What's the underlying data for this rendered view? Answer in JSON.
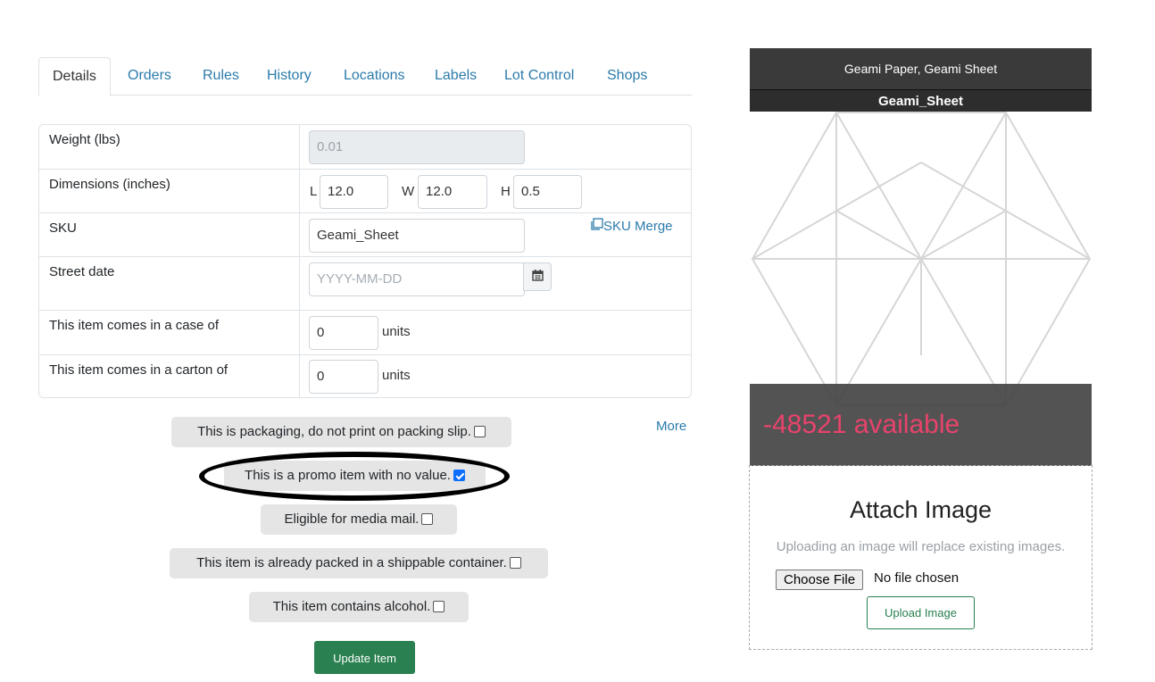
{
  "tabs": [
    {
      "label": "Details",
      "active": true
    },
    {
      "label": "Orders"
    },
    {
      "label": "Rules"
    },
    {
      "label": "History"
    },
    {
      "label": "Locations"
    },
    {
      "label": "Labels"
    },
    {
      "label": "Lot Control"
    },
    {
      "label": "Shops"
    }
  ],
  "form": {
    "weight": {
      "label": "Weight (lbs)",
      "value": "0.01"
    },
    "dimensions": {
      "label": "Dimensions (inches)",
      "l_label": "L",
      "l_value": "12.0",
      "w_label": "W",
      "w_value": "12.0",
      "h_label": "H",
      "h_value": "0.5"
    },
    "sku": {
      "label": "SKU",
      "value": "Geami_Sheet",
      "merge_label": "SKU Merge"
    },
    "street_date": {
      "label": "Street date",
      "placeholder": "YYYY-MM-DD",
      "icon": "calendar-icon"
    },
    "case": {
      "label": "This item comes in a case of",
      "value": "0",
      "units": "units"
    },
    "carton": {
      "label": "This item comes in a carton of",
      "value": "0",
      "units": "units"
    }
  },
  "more_link": "More",
  "options": [
    {
      "label": "This is packaging, do not print on packing slip.",
      "checked": false
    },
    {
      "label": "This is a promo item with no value.",
      "checked": true
    },
    {
      "label": "Eligible for media mail.",
      "checked": false
    },
    {
      "label": "This item is already packed in a shippable container.",
      "checked": false
    },
    {
      "label": "This item contains alcohol.",
      "checked": false
    }
  ],
  "update_button": "Update Item",
  "product_card": {
    "title": "Geami Paper, Geami Sheet",
    "sku": "Geami_Sheet",
    "available": "-48521 available",
    "placeholder_icon": "cube-placeholder-icon"
  },
  "attach": {
    "title": "Attach Image",
    "note": "Uploading an image will replace existing images.",
    "choose_label": "Choose File",
    "no_file": "No file chosen",
    "upload_label": "Upload Image"
  },
  "colors": {
    "link": "#2b7bab",
    "update_green": "#2a8050",
    "available_red": "#e8436c",
    "checkbox_blue": "#0d6efd"
  }
}
